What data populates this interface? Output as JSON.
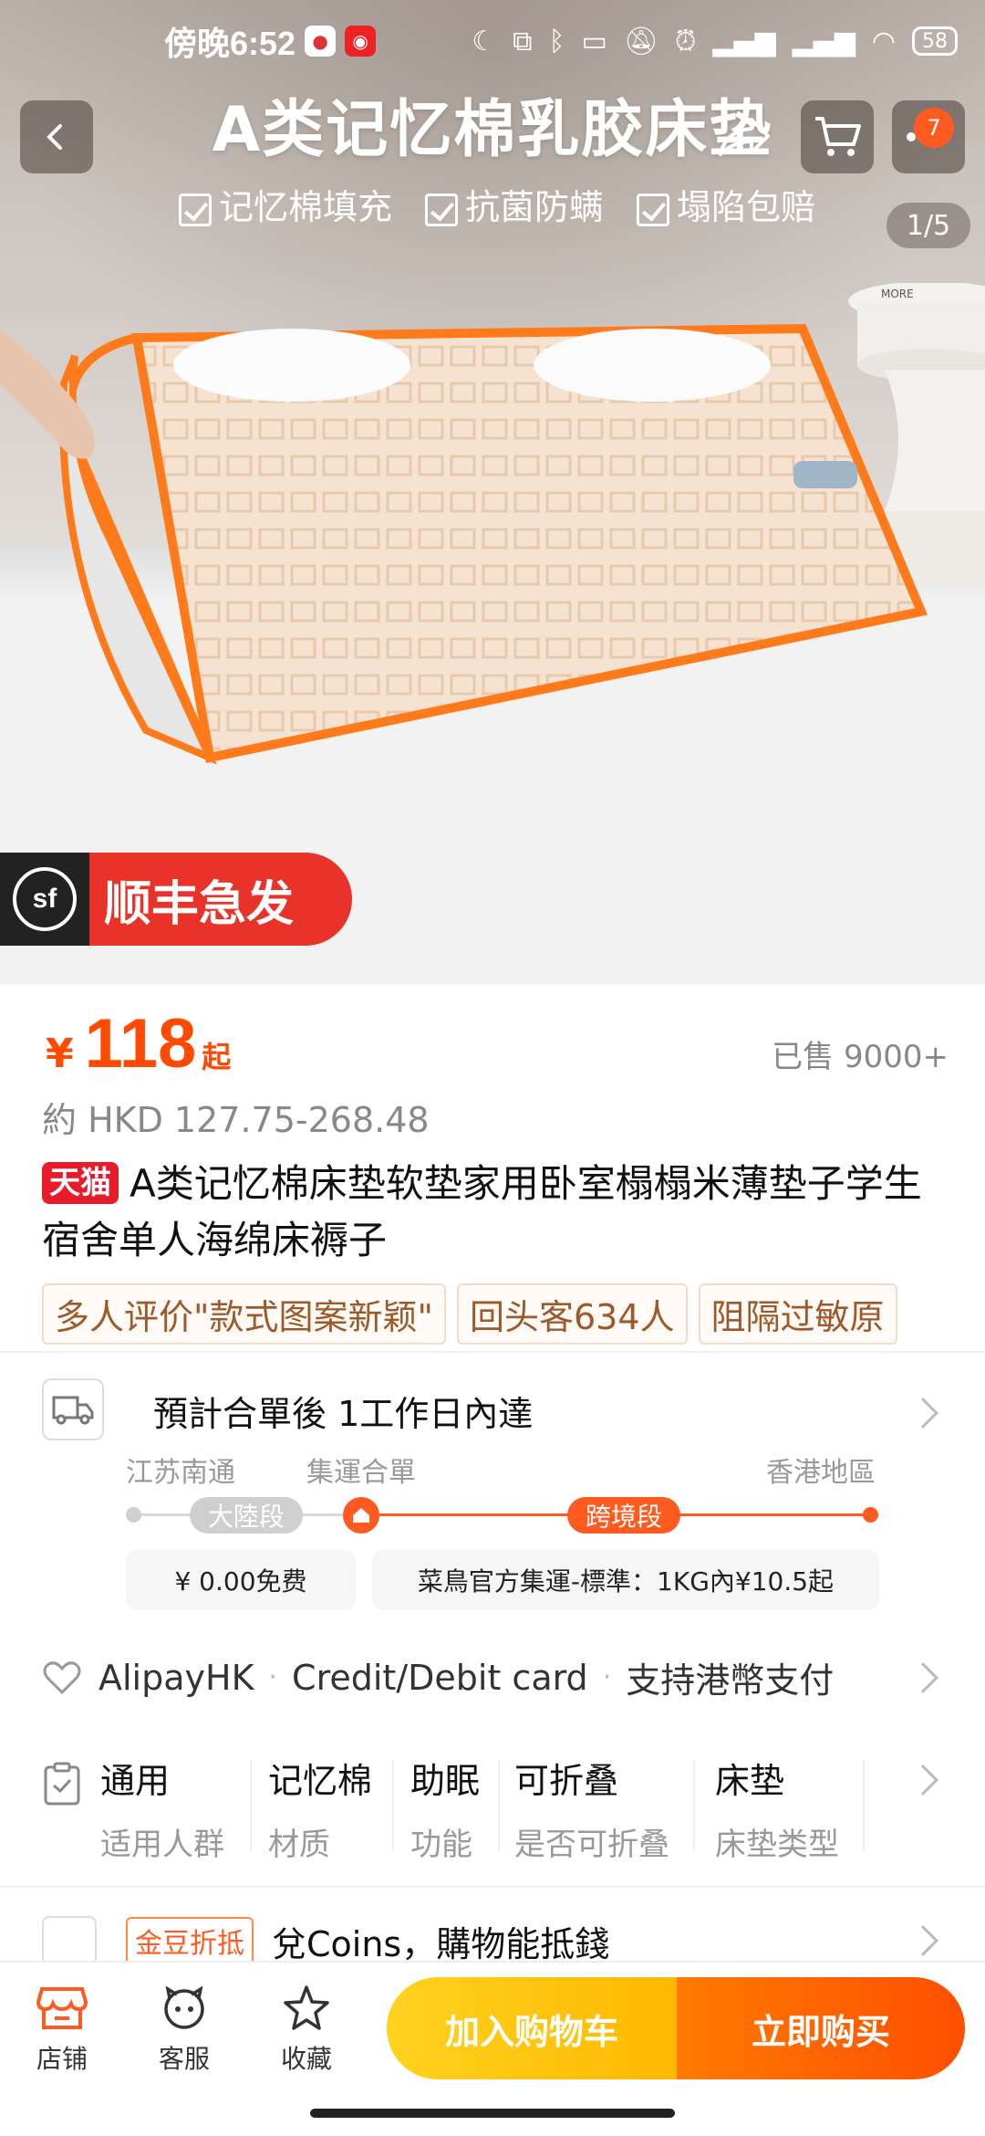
{
  "status_bar": {
    "time": "傍晚6:52",
    "battery": "58"
  },
  "hero": {
    "title": "A类记忆棉乳胶床垫",
    "features": [
      "记忆棉填充",
      "抗菌防螨",
      "塌陷包赔"
    ],
    "cart_badge": "7",
    "image_counter": "1/5",
    "sf_logo": "sf",
    "sf_text": "顺丰急发",
    "table_text": "MORE"
  },
  "price": {
    "currency": "¥",
    "amount": "118",
    "suffix": "起",
    "sold": "已售 9000+",
    "hkd": "約 HKD 127.75-268.48"
  },
  "product": {
    "store_tag": "天猫",
    "title": "A类记忆棉床垫软垫家用卧室榻榻米薄垫子学生宿舍单人海绵床褥子",
    "tags": [
      "多人评价\"款式图案新颖\"",
      "回头客634人",
      "阻隔过敏原"
    ]
  },
  "shipping": {
    "title": "預計合單後 1工作日內達",
    "from": "江苏南通",
    "hub": "集運合單",
    "to": "香港地區",
    "segment1": "大陸段",
    "segment2": "跨境段",
    "fee1": "¥ 0.00免费",
    "fee2": "菜鳥官方集運-標準：1KG內¥10.5起"
  },
  "payment": {
    "method1": "AlipayHK",
    "method2": "Credit/Debit card",
    "method3": "支持港幣支付"
  },
  "attributes": [
    {
      "value": "通用",
      "key": "适用人群"
    },
    {
      "value": "记忆棉",
      "key": "材质"
    },
    {
      "value": "助眠",
      "key": "功能"
    },
    {
      "value": "可折叠",
      "key": "是否可折叠"
    },
    {
      "value": "床垫",
      "key": "床垫类型"
    }
  ],
  "coins": {
    "tag": "金豆折抵",
    "text": "兌Coins，購物能抵錢"
  },
  "bottom_bar": {
    "store": "店铺",
    "service": "客服",
    "favorite": "收藏",
    "add_to_cart": "加入购物车",
    "buy_now": "立即购买"
  },
  "colors": {
    "accent": "#ff5a1f",
    "price": "#ff4a00",
    "tmall": "#e81b2b",
    "cart_button": "#ffc107",
    "buy_button": "#ff5500"
  }
}
